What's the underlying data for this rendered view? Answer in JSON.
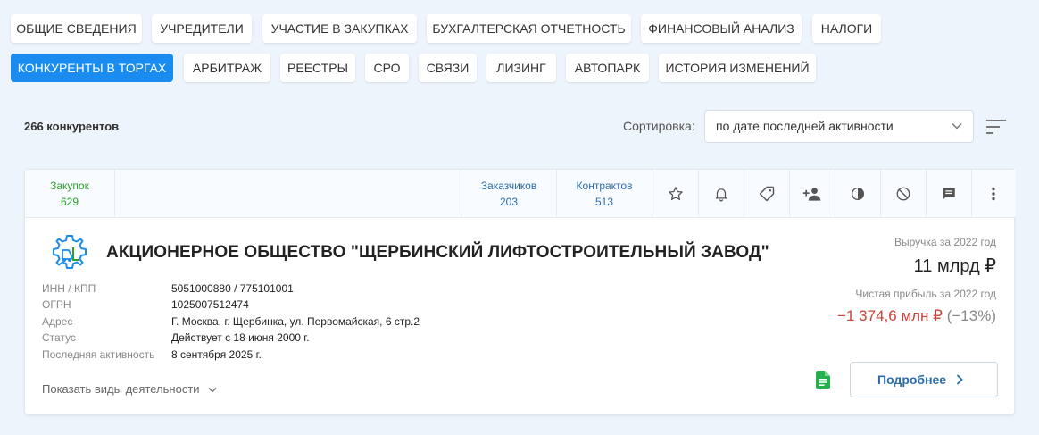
{
  "tabs_row1": [
    {
      "label": "ОБЩИЕ СВЕДЕНИЯ",
      "active": false
    },
    {
      "label": "УЧРЕДИТЕЛИ",
      "active": false
    },
    {
      "label": "УЧАСТИЕ В ЗАКУПКАХ",
      "active": false
    },
    {
      "label": "БУХГАЛТЕРСКАЯ ОТЧЕТНОСТЬ",
      "active": false
    },
    {
      "label": "ФИНАНСОВЫЙ АНАЛИЗ",
      "active": false
    },
    {
      "label": "НАЛОГИ",
      "active": false
    }
  ],
  "tabs_row2": [
    {
      "label": "КОНКУРЕНТЫ В ТОРГАХ",
      "active": true
    },
    {
      "label": "АРБИТРАЖ",
      "active": false
    },
    {
      "label": "РЕЕСТРЫ",
      "active": false
    },
    {
      "label": "СРО",
      "active": false
    },
    {
      "label": "СВЯЗИ",
      "active": false
    },
    {
      "label": "ЛИЗИНГ",
      "active": false
    },
    {
      "label": "АВТОПАРК",
      "active": false
    },
    {
      "label": "ИСТОРИЯ ИЗМЕНЕНИЙ",
      "active": false
    }
  ],
  "competitors_count": "266 конкурентов",
  "sort": {
    "label": "Сортировка:",
    "value": "по дате последней активности"
  },
  "card": {
    "stats": {
      "purchases": {
        "label": "Закупок",
        "value": "629"
      },
      "customers": {
        "label": "Заказчиков",
        "value": "203"
      },
      "contracts": {
        "label": "Контрактов",
        "value": "513"
      }
    },
    "action_icons": [
      "star-icon",
      "bell-icon",
      "tag-icon",
      "add-person-icon",
      "contrast-icon",
      "block-icon",
      "comment-icon",
      "more-vertical-icon"
    ],
    "company_name": "АКЦИОНЕРНОЕ ОБЩЕСТВО \"ЩЕРБИНСКИЙ ЛИФТОСТРОИТЕЛЬНЫЙ ЗАВОД\"",
    "details": [
      {
        "key": "ИНН / КПП",
        "value": "5051000880 / 775101001"
      },
      {
        "key": "ОГРН",
        "value": "1025007512474"
      },
      {
        "key": "Адрес",
        "value": "Г. Москва, г. Щербинка, ул. Первомайская, 6 стр.2"
      },
      {
        "key": "Статус",
        "value": "Действует с 18 июня 2000 г."
      },
      {
        "key": "Последняя активность",
        "value": "8 сентября 2025 г."
      }
    ],
    "show_activities": "Показать виды деятельности",
    "revenue_label": "Выручка за 2022 год",
    "revenue_value": "11 млрд ₽",
    "profit_label": "Чистая прибыль за 2022 год",
    "profit_value": "−1 374,6 млн ₽",
    "profit_pct": "(−13%)",
    "more_button": "Подробнее"
  },
  "colors": {
    "accent": "#1a8cf0",
    "green": "#2ca02c",
    "link_blue": "#2b6cb0",
    "negative": "#c9433a",
    "background": "#eef4fb"
  }
}
